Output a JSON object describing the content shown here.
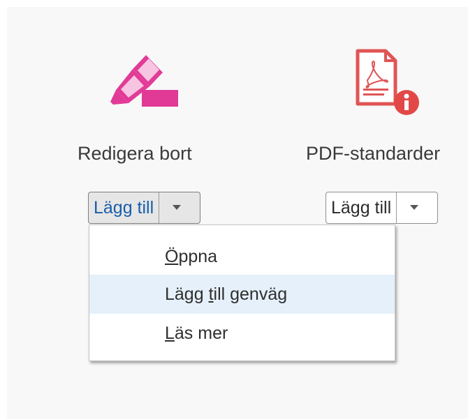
{
  "tools": [
    {
      "name": "Redigera bort",
      "icon": "redact-marker-icon",
      "button": {
        "label": "Lägg till",
        "dropdown": "chevron-down-icon"
      }
    },
    {
      "name": "PDF-standarder",
      "icon": "pdf-standards-icon",
      "button": {
        "label": "Lägg till",
        "dropdown": "chevron-down-icon"
      }
    }
  ],
  "menu": {
    "items": [
      {
        "accel": "Ö",
        "rest_before": "",
        "rest_after": "ppna",
        "full": "Öppna"
      },
      {
        "accel": "t",
        "rest_before": "Lägg ",
        "rest_after": "ill genväg",
        "full": "Lägg till genväg",
        "highlighted": true
      },
      {
        "accel": "L",
        "rest_before": "",
        "rest_after": "äs mer",
        "full": "Läs mer"
      }
    ]
  },
  "colors": {
    "redact_accent": "#e03a96",
    "pdf_accent": "#e05555",
    "link_blue": "#1a5ea8",
    "menu_highlight": "#e5f0fa"
  }
}
